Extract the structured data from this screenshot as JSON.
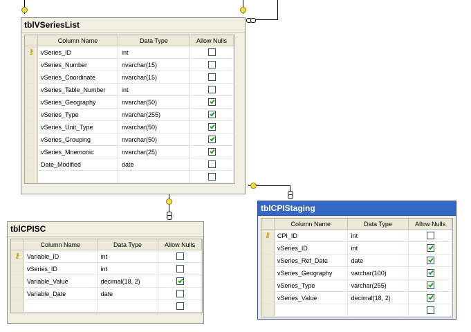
{
  "columns": {
    "column_name": "Column Name",
    "data_type": "Data Type",
    "allow_nulls": "Allow Nulls"
  },
  "tables": {
    "series_list": {
      "title": "tblVSeriesList",
      "rows": [
        {
          "name": "vSeries_ID",
          "type": "int",
          "nulls": false,
          "pk": true
        },
        {
          "name": "vSeries_Number",
          "type": "nvarchar(15)",
          "nulls": false
        },
        {
          "name": "vSeries_Coordinate",
          "type": "nvarchar(15)",
          "nulls": false
        },
        {
          "name": "vSeries_Table_Number",
          "type": "int",
          "nulls": false
        },
        {
          "name": "vSeries_Geography",
          "type": "nvarchar(50)",
          "nulls": true
        },
        {
          "name": "vSeries_Type",
          "type": "nvarchar(255)",
          "nulls": true
        },
        {
          "name": "vSeries_Unit_Type",
          "type": "nvarchar(50)",
          "nulls": true
        },
        {
          "name": "vSeries_Grouping",
          "type": "nvarchar(50)",
          "nulls": true
        },
        {
          "name": "vSeries_Mnemonic",
          "type": "nvarchar(25)",
          "nulls": true
        },
        {
          "name": "Date_Modified",
          "type": "date",
          "nulls": false
        },
        {
          "name": "",
          "type": "",
          "nulls": false
        }
      ]
    },
    "cpisc": {
      "title": "tblCPISC",
      "rows": [
        {
          "name": "Variable_ID",
          "type": "int",
          "nulls": false,
          "pk": true
        },
        {
          "name": "vSeries_ID",
          "type": "int",
          "nulls": false
        },
        {
          "name": "Variable_Value",
          "type": "decimal(18, 2)",
          "nulls": true
        },
        {
          "name": "Variable_Date",
          "type": "date",
          "nulls": false
        },
        {
          "name": "",
          "type": "",
          "nulls": false
        }
      ]
    },
    "cpi_staging": {
      "title": "tblCPIStaging",
      "rows": [
        {
          "name": "CPI_ID",
          "type": "int",
          "nulls": false,
          "pk": true
        },
        {
          "name": "vSeries_ID",
          "type": "int",
          "nulls": true
        },
        {
          "name": "vSeries_Ref_Date",
          "type": "date",
          "nulls": true
        },
        {
          "name": "vSeries_Geography",
          "type": "varchar(100)",
          "nulls": true
        },
        {
          "name": "vSeries_Type",
          "type": "varchar(255)",
          "nulls": true
        },
        {
          "name": "vSeries_Value",
          "type": "decimal(18, 2)",
          "nulls": true
        },
        {
          "name": "",
          "type": "",
          "nulls": false
        }
      ]
    }
  }
}
